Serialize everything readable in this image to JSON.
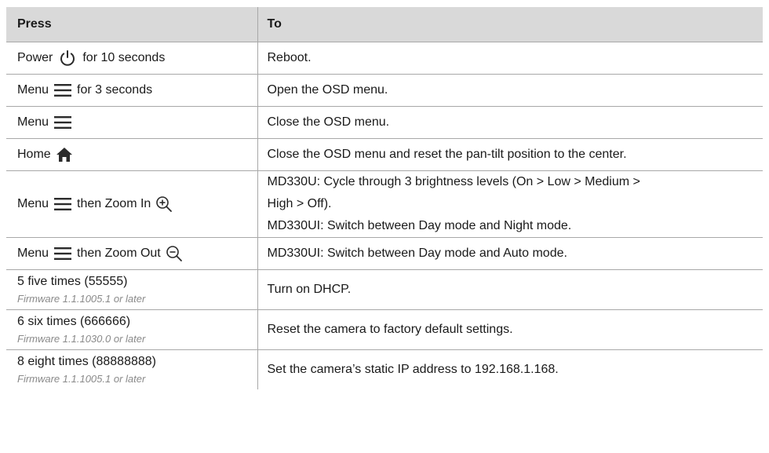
{
  "table": {
    "headers": {
      "press": "Press",
      "to": "To"
    },
    "rows": [
      {
        "press": {
          "before": "Power",
          "icon": "power-icon",
          "after": "for 10 seconds"
        },
        "to": [
          "Reboot."
        ]
      },
      {
        "press": {
          "before": "Menu",
          "icon": "menu-icon",
          "after": "for 3 seconds"
        },
        "to": [
          "Open the OSD menu."
        ]
      },
      {
        "press": {
          "before": "Menu",
          "icon": "menu-icon",
          "after": ""
        },
        "to": [
          "Close the OSD menu."
        ]
      },
      {
        "press": {
          "before": "Home",
          "icon": "home-icon",
          "after": ""
        },
        "to": [
          "Close the OSD menu and reset the pan-tilt position to the center."
        ]
      },
      {
        "press": {
          "before": "Menu",
          "icon": "menu-icon",
          "middle": "then Zoom In",
          "icon2": "zoom-in-icon"
        },
        "to": [
          "MD330U: Cycle through 3 brightness levels (On > Low > Medium >",
          "High > Off).",
          "MD330UI: Switch between Day mode and Night mode."
        ]
      },
      {
        "press": {
          "before": "Menu",
          "icon": "menu-icon",
          "middle": "then Zoom Out",
          "icon2": "zoom-out-icon"
        },
        "to": [
          "MD330UI: Switch between Day mode and Auto mode."
        ]
      },
      {
        "press": {
          "text": "5 five times (55555)",
          "note": "Firmware 1.1.1005.1 or later"
        },
        "to": [
          "Turn on DHCP."
        ]
      },
      {
        "press": {
          "text": "6 six times (666666)",
          "note": "Firmware 1.1.1030.0 or later"
        },
        "to": [
          "Reset the camera to factory default settings."
        ]
      },
      {
        "press": {
          "text": "8 eight times (88888888)",
          "note": "Firmware 1.1.1005.1 or later"
        },
        "to": [
          "Set the camera’s static IP address to 192.168.1.168."
        ]
      }
    ]
  },
  "colors": {
    "header_bg": "#d9d9d9",
    "border": "#a8a8a8",
    "note_text": "#8a8a8a"
  }
}
